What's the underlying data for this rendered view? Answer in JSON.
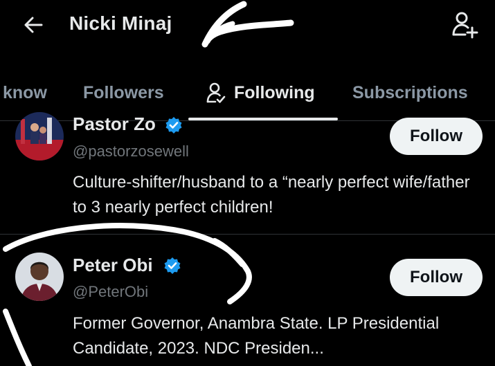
{
  "header": {
    "title": "Nicki Minaj",
    "back_icon": "arrow-left-icon",
    "add_user_icon": "add-user-icon"
  },
  "tabs": [
    {
      "label": "know",
      "active": false
    },
    {
      "label": "Followers",
      "active": false
    },
    {
      "label": "Following",
      "active": true,
      "icon": "person-check-icon"
    },
    {
      "label": "Subscriptions",
      "active": false
    }
  ],
  "users": [
    {
      "name": "Pastor Zo",
      "handle": "@pastorzosewell",
      "verified": true,
      "bio": "Culture-shifter/husband to a “nearly perfect wife/father to 3 nearly perfect children!",
      "follow_label": "Follow"
    },
    {
      "name": "Peter Obi",
      "handle": "@PeterObi",
      "verified": true,
      "bio": "Former Governor, Anambra State. LP Presidential Candidate, 2023. NDC Presiden...",
      "follow_label": "Follow"
    }
  ],
  "colors": {
    "background": "#000000",
    "verified": "#1d9bf0",
    "muted": "#71767b",
    "button_bg": "#eff3f4"
  }
}
